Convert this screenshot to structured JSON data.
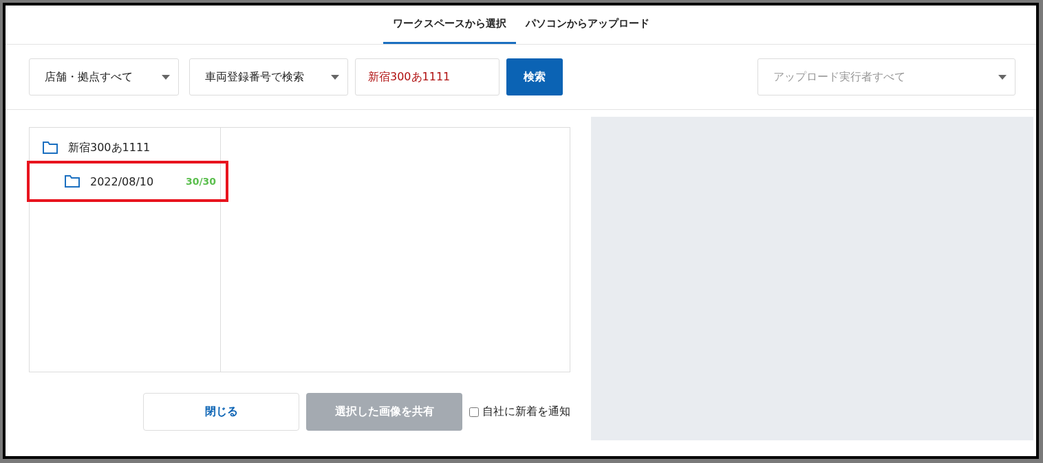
{
  "tabs": [
    {
      "label": "ワークスペースから選択",
      "selected": true
    },
    {
      "label": "パソコンからアップロード",
      "selected": false
    }
  ],
  "filters": {
    "store_select": {
      "value": "店舗・拠点すべて"
    },
    "search_type_select": {
      "value": "車両登録番号で検索"
    },
    "search_field": {
      "value": "新宿300あ1111"
    },
    "search_button": {
      "label": "検索"
    },
    "uploader_select": {
      "placeholder": "アップロード実行者すべて"
    }
  },
  "folder_tree": [
    {
      "label": "新宿300あ1111",
      "highlighted": false,
      "children": [
        {
          "label": "2022/08/10",
          "count": "30/30",
          "highlighted": true
        }
      ]
    }
  ],
  "footer": {
    "close_button": {
      "label": "閉じる",
      "disabled": false
    },
    "share_button": {
      "label": "選択した画像を共有",
      "disabled": true
    },
    "notify_checkbox": {
      "label": "自社に新着を通知",
      "checked": false
    }
  }
}
